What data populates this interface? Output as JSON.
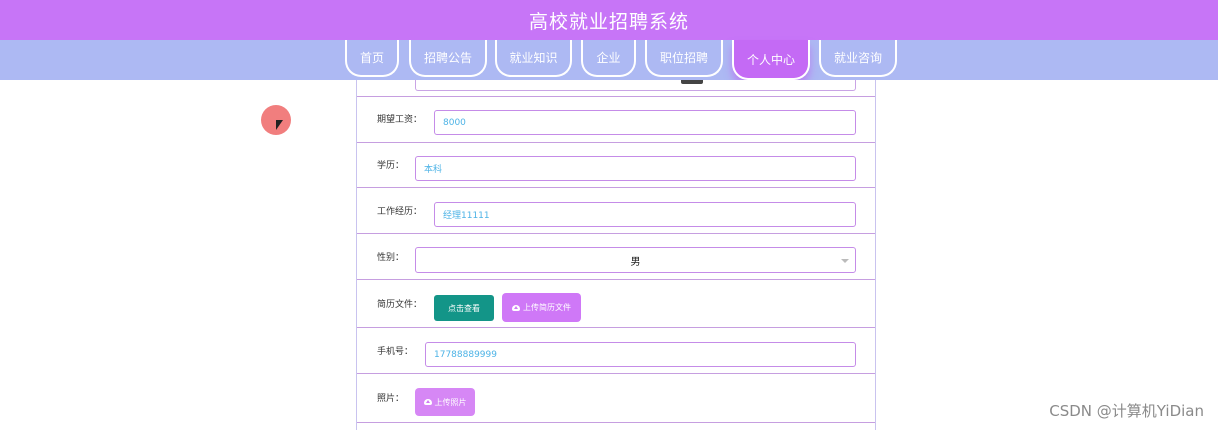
{
  "header": {
    "title": "高校就业招聘系统"
  },
  "nav": {
    "items": [
      {
        "label": "首页"
      },
      {
        "label": "招聘公告"
      },
      {
        "label": "就业知识"
      },
      {
        "label": "企业"
      },
      {
        "label": "职位招聘"
      },
      {
        "label": "个人中心",
        "active": true
      },
      {
        "label": "就业咨询"
      }
    ]
  },
  "form": {
    "expected_salary": {
      "label": "期望工资：",
      "value": "8000"
    },
    "education": {
      "label": "学历：",
      "value": "本科"
    },
    "work_experience": {
      "label": "工作经历：",
      "value": "经理11111"
    },
    "gender": {
      "label": "性别：",
      "value": "男"
    },
    "resume": {
      "label": "简历文件：",
      "view_button": "点击查看",
      "upload_button": "上传简历文件"
    },
    "phone": {
      "label": "手机号：",
      "value": "17788889999"
    },
    "photo": {
      "label": "照片：",
      "upload_button": "上传照片"
    }
  },
  "watermark": "CSDN @计算机YiDian",
  "colors": {
    "header_bg": "#c775f7",
    "nav_bg": "#adb9f3",
    "accent": "#cf78f7",
    "teal": "#139588"
  }
}
